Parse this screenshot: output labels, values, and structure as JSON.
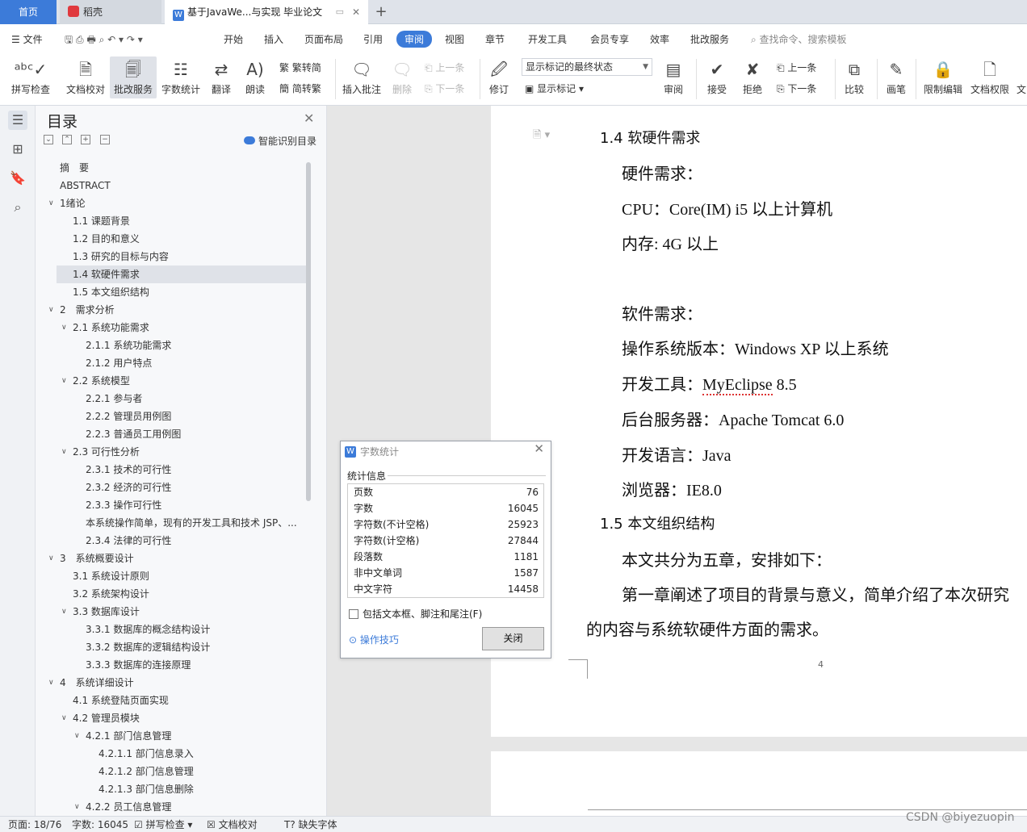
{
  "tabs": {
    "home": "首页",
    "daoke": "稻壳",
    "doc": "基于JavaWe...与实现 毕业论文",
    "doc_icon": "W",
    "add": "+",
    "close": "✕"
  },
  "menu": {
    "file": "文件",
    "items": [
      "开始",
      "插入",
      "页面布局",
      "引用",
      "审阅",
      "视图",
      "章节",
      "开发工具",
      "会员专享",
      "效率",
      "批改服务"
    ],
    "active": "审阅",
    "search": "查找命令、搜索模板"
  },
  "ribbon": {
    "spell": "拼写检查",
    "proof": "文档校对",
    "revise": "批改服务",
    "wordcount": "字数统计",
    "translate": "翻译",
    "read": "朗读",
    "trad": "繁转简",
    "simp": "简转繁",
    "insert_comment": "插入批注",
    "delete": "删除",
    "prev": "上一条",
    "next": "下一条",
    "track": "修订",
    "markup_state": "显示标记的最终状态",
    "show_markup": "显示标记",
    "review": "审阅",
    "accept": "接受",
    "reject": "拒绝",
    "prev2": "上一条",
    "next2": "下一条",
    "compare": "比较",
    "pen": "画笔",
    "restrict": "限制编辑",
    "permission": "文档权限",
    "more": "文"
  },
  "toc": {
    "title": "目录",
    "smart": "智能识别目录",
    "items": [
      {
        "text": "摘　要",
        "level": 0,
        "chev": false
      },
      {
        "text": "ABSTRACT",
        "level": 0,
        "chev": false
      },
      {
        "text": "1绪论",
        "level": 0,
        "chev": true
      },
      {
        "text": "1.1 课题背景",
        "level": 1,
        "chev": false
      },
      {
        "text": "1.2 目的和意义",
        "level": 1,
        "chev": false
      },
      {
        "text": "1.3 研究的目标与内容",
        "level": 1,
        "chev": false
      },
      {
        "text": "1.4 软硬件需求",
        "level": 1,
        "chev": false,
        "selected": true
      },
      {
        "text": "1.5 本文组织结构",
        "level": 1,
        "chev": false
      },
      {
        "text": "2　需求分析",
        "level": 0,
        "chev": true
      },
      {
        "text": "2.1 系统功能需求",
        "level": 1,
        "chev": true
      },
      {
        "text": "2.1.1 系统功能需求",
        "level": 2,
        "chev": false
      },
      {
        "text": "2.1.2 用户特点",
        "level": 2,
        "chev": false
      },
      {
        "text": "2.2 系统模型",
        "level": 1,
        "chev": true
      },
      {
        "text": "2.2.1 参与者",
        "level": 2,
        "chev": false
      },
      {
        "text": "2.2.2 管理员用例图",
        "level": 2,
        "chev": false
      },
      {
        "text": "2.2.3 普通员工用例图",
        "level": 2,
        "chev": false
      },
      {
        "text": "2.3 可行性分析",
        "level": 1,
        "chev": true
      },
      {
        "text": "2.3.1 技术的可行性",
        "level": 2,
        "chev": false
      },
      {
        "text": "2.3.2 经济的可行性",
        "level": 2,
        "chev": false
      },
      {
        "text": "2.3.3 操作可行性",
        "level": 2,
        "chev": false
      },
      {
        "text": "本系统操作简单，现有的开发工具和技术 JSP、...",
        "level": 2,
        "chev": false
      },
      {
        "text": "2.3.4 法律的可行性",
        "level": 2,
        "chev": false
      },
      {
        "text": "3　系统概要设计",
        "level": 0,
        "chev": true
      },
      {
        "text": "3.1 系统设计原则",
        "level": 1,
        "chev": false
      },
      {
        "text": "3.2 系统架构设计",
        "level": 1,
        "chev": false
      },
      {
        "text": "3.3 数据库设计",
        "level": 1,
        "chev": true
      },
      {
        "text": "3.3.1 数据库的概念结构设计",
        "level": 2,
        "chev": false
      },
      {
        "text": "3.3.2 数据库的逻辑结构设计",
        "level": 2,
        "chev": false
      },
      {
        "text": "3.3.3 数据库的连接原理",
        "level": 2,
        "chev": false
      },
      {
        "text": "4　系统详细设计",
        "level": 0,
        "chev": true
      },
      {
        "text": "4.1 系统登陆页面实现",
        "level": 1,
        "chev": false
      },
      {
        "text": "4.2 管理员模块",
        "level": 1,
        "chev": true
      },
      {
        "text": "4.2.1 部门信息管理",
        "level": 2,
        "chev": true
      },
      {
        "text": "4.2.1.1 部门信息录入",
        "level": 3,
        "chev": false
      },
      {
        "text": "4.2.1.2 部门信息管理",
        "level": 3,
        "chev": false
      },
      {
        "text": "4.2.1.3 部门信息删除",
        "level": 3,
        "chev": false
      },
      {
        "text": "4.2.2 员工信息管理",
        "level": 2,
        "chev": true
      }
    ]
  },
  "doc": {
    "h14": "1.4 软硬件需求",
    "hw": "硬件需求：",
    "cpu": "CPU：Core(IM) i5 以上计算机",
    "mem": "内存: 4G 以上",
    "sw": "软件需求：",
    "os": "操作系统版本：Windows XP 以上系统",
    "tool_label": "开发工具：",
    "tool_name": "MyEclipse",
    "tool_ver": " 8.5",
    "server": "后台服务器：Apache Tomcat 6.0",
    "lang": "开发语言：Java",
    "browser": "浏览器：IE8.0",
    "h15": "1.5 本文组织结构",
    "p1": "本文共分为五章，安排如下：",
    "p2a": "第一章阐述了项目的背景与意义，简单介绍了本次研究",
    "p2b": "的内容与系统软硬件方面的需求。",
    "page_no": "4"
  },
  "dialog": {
    "title": "字数统计",
    "group": "统计信息",
    "rows": [
      {
        "label": "页数",
        "value": "76"
      },
      {
        "label": "字数",
        "value": "16045"
      },
      {
        "label": "字符数(不计空格)",
        "value": "25923"
      },
      {
        "label": "字符数(计空格)",
        "value": "27844"
      },
      {
        "label": "段落数",
        "value": "1181"
      },
      {
        "label": "非中文单词",
        "value": "1587"
      },
      {
        "label": "中文字符",
        "value": "14458"
      }
    ],
    "checkbox": "包括文本框、脚注和尾注(F)",
    "tips": "操作技巧",
    "close": "关闭"
  },
  "status": {
    "page": "页面: 18/76",
    "words": "字数: 16045",
    "spell": "拼写检查",
    "proof": "文档校对",
    "font": "缺失字体"
  },
  "watermark": "CSDN @biyezuopin"
}
